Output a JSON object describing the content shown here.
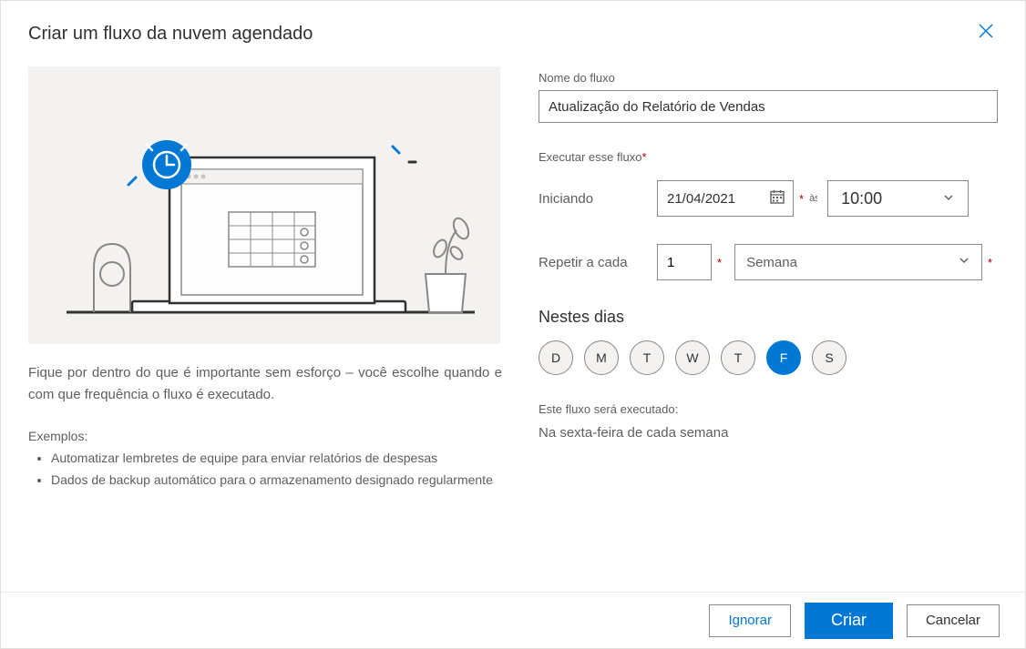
{
  "dialog": {
    "title": "Criar um fluxo da nuvem agendado"
  },
  "left": {
    "description": "Fique por dentro do que é importante sem esforço – você escolhe quando e com que frequência o fluxo é executado.",
    "examples_label": "Exemplos:",
    "examples": [
      "Automatizar lembretes de equipe para enviar relatórios de despesas",
      "Dados de backup automático para o armazenamento designado regularmente"
    ]
  },
  "form": {
    "name_label": "Nome do fluxo",
    "name_value": "Atualização do Relatório de Vendas",
    "run_heading": "Executar esse fluxo",
    "starting_label": "Iniciando",
    "starting_date": "21/04/2021",
    "at_label": "às",
    "time_value": "10:00",
    "repeat_label": "Repetir a cada",
    "repeat_value": "1",
    "repeat_unit": "Semana",
    "days_heading": "Nestes dias",
    "days": [
      {
        "abbr": "D",
        "selected": false
      },
      {
        "abbr": "M",
        "selected": false
      },
      {
        "abbr": "T",
        "selected": false
      },
      {
        "abbr": "W",
        "selected": false
      },
      {
        "abbr": "T",
        "selected": false
      },
      {
        "abbr": "F",
        "selected": true
      },
      {
        "abbr": "S",
        "selected": false
      }
    ],
    "summary_label": "Este fluxo será executado:",
    "summary_text": "Na sexta-feira de cada semana"
  },
  "footer": {
    "skip": "Ignorar",
    "create": "Criar",
    "cancel": "Cancelar"
  }
}
